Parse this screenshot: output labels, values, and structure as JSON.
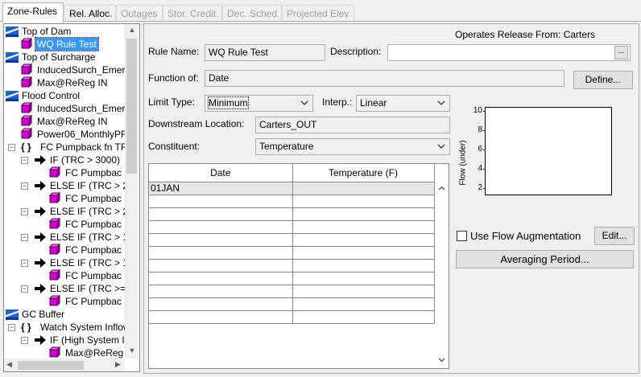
{
  "tabs": [
    {
      "label": "Zone-Rules",
      "state": "active"
    },
    {
      "label": "Rel. Alloc.",
      "state": "enabled"
    },
    {
      "label": "Outages",
      "state": "disabled"
    },
    {
      "label": "Stor. Credit",
      "state": "disabled"
    },
    {
      "label": "Dec. Sched.",
      "state": "disabled"
    },
    {
      "label": "Projected Elev",
      "state": "disabled"
    }
  ],
  "tree": {
    "rows": [
      {
        "label": "Top of Dam",
        "icon": "zone-icon"
      },
      {
        "label": "WQ Rule Test",
        "icon": "rule-icon",
        "selected": true
      },
      {
        "label": "Top of Surcharge",
        "icon": "zone-icon"
      },
      {
        "label": "InducedSurch_Emer",
        "icon": "rule-icon"
      },
      {
        "label": "Max@ReReg IN",
        "icon": "rule-icon"
      },
      {
        "label": "Flood Control",
        "icon": "zone-icon"
      },
      {
        "label": "InducedSurch_Emer",
        "icon": "rule-icon"
      },
      {
        "label": "Max@ReReg IN",
        "icon": "rule-icon"
      },
      {
        "label": "Power06_MonthlyPF",
        "icon": "rule-icon"
      },
      {
        "label": "FC Pumpback fn TR",
        "icon": "braces-icon"
      },
      {
        "label": "IF (TRC > 3000)",
        "icon": "arrow-icon"
      },
      {
        "label": "FC Pumpbac",
        "icon": "rule-icon"
      },
      {
        "label": "ELSE IF (TRC > 2",
        "icon": "arrow-icon"
      },
      {
        "label": "FC Pumpbac",
        "icon": "rule-icon"
      },
      {
        "label": "ELSE IF (TRC > 2",
        "icon": "arrow-icon"
      },
      {
        "label": "FC Pumpbac",
        "icon": "rule-icon"
      },
      {
        "label": "ELSE IF (TRC > 1",
        "icon": "arrow-icon"
      },
      {
        "label": "FC Pumpbac",
        "icon": "rule-icon"
      },
      {
        "label": "ELSE IF (TRC > 1",
        "icon": "arrow-icon"
      },
      {
        "label": "FC Pumpbac",
        "icon": "rule-icon"
      },
      {
        "label": "ELSE IF (TRC >=",
        "icon": "arrow-icon"
      },
      {
        "label": "FC Pumpbac",
        "icon": "rule-icon"
      },
      {
        "label": "GC Buffer",
        "icon": "zone-icon"
      },
      {
        "label": "Watch System Inflow",
        "icon": "braces-icon"
      },
      {
        "label": "IF (High System I",
        "icon": "arrow-icon"
      },
      {
        "label": "Max@ReReg",
        "icon": "rule-icon"
      }
    ],
    "expander_symbol": "−"
  },
  "form": {
    "operates_release_from": "Operates Release From: Carters",
    "rule_name_label": "Rule Name:",
    "rule_name_value": "WQ Rule Test",
    "description_label": "Description:",
    "description_value": "",
    "description_button": "...",
    "function_of_label": "Function of:",
    "function_of_value": "Date",
    "define_button": "Define...",
    "limit_type_label": "Limit Type:",
    "limit_type_value": "Minimum",
    "interp_label": "Interp.:",
    "interp_value": "Linear",
    "downstream_label": "Downstream Location:",
    "downstream_value": "Carters_OUT",
    "constituent_label": "Constituent:",
    "constituent_value": "Temperature"
  },
  "table": {
    "columns": [
      "Date",
      "Temperature (F)"
    ],
    "rows": [
      [
        "01JAN",
        ""
      ],
      [
        "",
        ""
      ],
      [
        "",
        ""
      ],
      [
        "",
        ""
      ],
      [
        "",
        ""
      ],
      [
        "",
        ""
      ],
      [
        "",
        ""
      ],
      [
        "",
        ""
      ],
      [
        "",
        ""
      ],
      [
        "",
        ""
      ],
      [
        "",
        ""
      ]
    ]
  },
  "chart": {
    "y_axis_label": "Flow (under)",
    "y_ticks": [
      "10",
      "8",
      "6",
      "4",
      "2"
    ]
  },
  "flow_augmentation": {
    "label": "Use Flow Augmentation",
    "checked": false,
    "edit_button": "Edit..."
  },
  "averaging_period_button": "Averaging Period..."
}
